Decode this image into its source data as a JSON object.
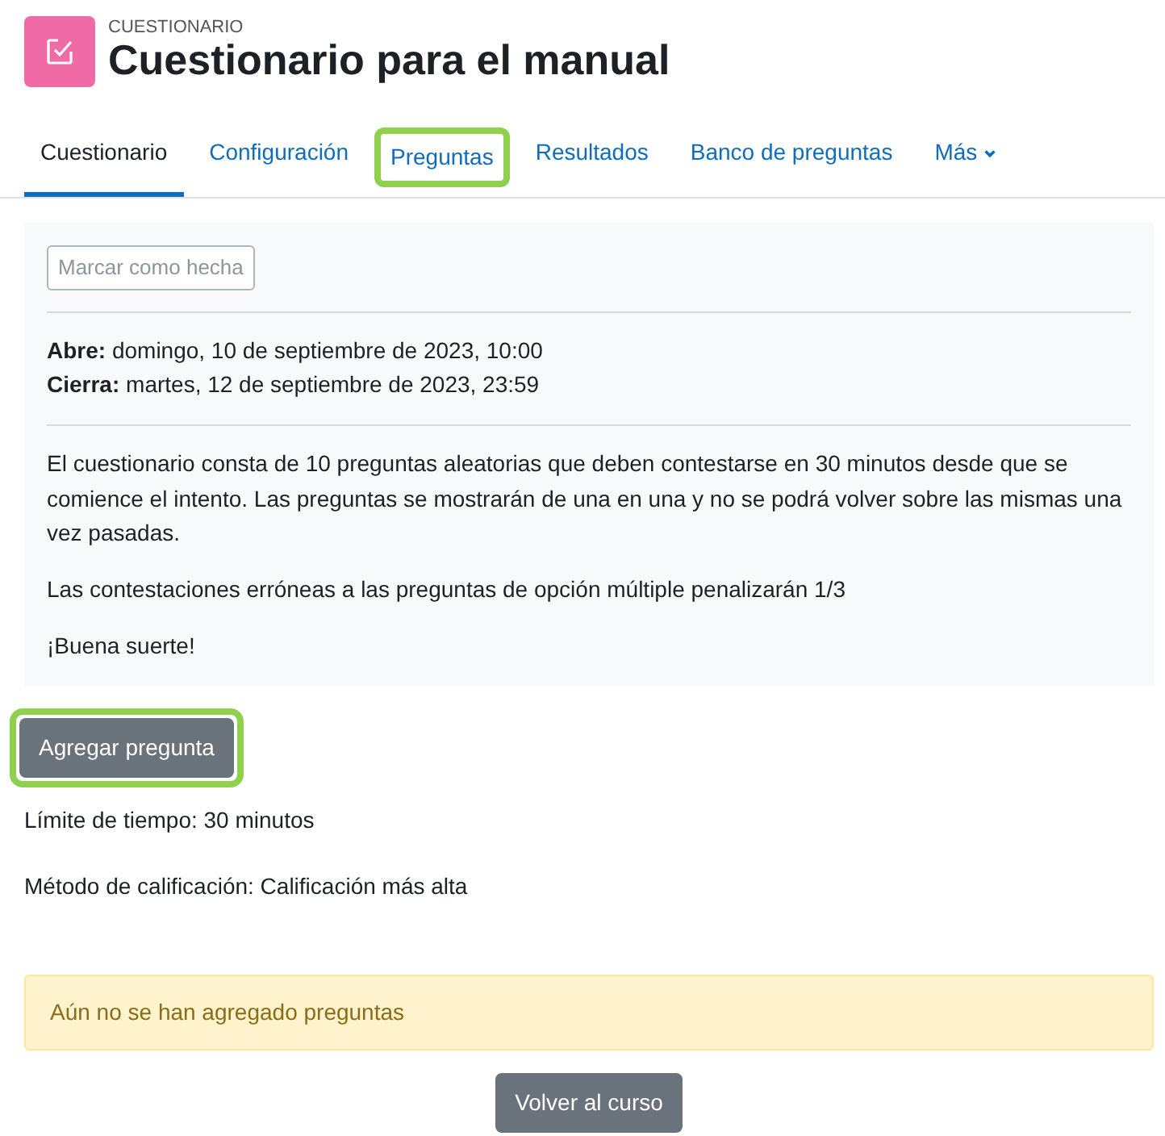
{
  "header": {
    "kicker": "CUESTIONARIO",
    "title": "Cuestionario para el manual"
  },
  "tabs": [
    {
      "label": "Cuestionario",
      "selected": true,
      "highlighted": false
    },
    {
      "label": "Configuración",
      "selected": false,
      "highlighted": false
    },
    {
      "label": "Preguntas",
      "selected": false,
      "highlighted": true
    },
    {
      "label": "Resultados",
      "selected": false,
      "highlighted": false
    },
    {
      "label": "Banco de preguntas",
      "selected": false,
      "highlighted": false
    },
    {
      "label": "Más",
      "selected": false,
      "highlighted": false,
      "kind": "dropdown"
    }
  ],
  "completion_button": {
    "label": "Marcar como hecha"
  },
  "dates": [
    {
      "label": "Abre:",
      "value": "domingo, 10 de septiembre de 2023, 10:00"
    },
    {
      "label": "Cierra:",
      "value": "martes, 12 de septiembre de 2023, 23:59"
    }
  ],
  "description": [
    "El cuestionario consta de 10 preguntas aleatorias que deben contestarse en 30 minutos desde que se comience el intento. Las preguntas se mostrarán de una en una y no se podrá volver sobre las mismas una vez pasadas.",
    "Las contestaciones erróneas a las preguntas de opción múltiple penalizarán 1/3",
    "¡Buena suerte!"
  ],
  "add_button": {
    "label": "Agregar pregunta",
    "highlighted": true
  },
  "info": [
    "Límite de tiempo: 30 minutos",
    "Método de calificación: Calificación más alta"
  ],
  "alert": "Aún no se han agregado preguntas",
  "back_button": {
    "label": "Volver al curso"
  }
}
